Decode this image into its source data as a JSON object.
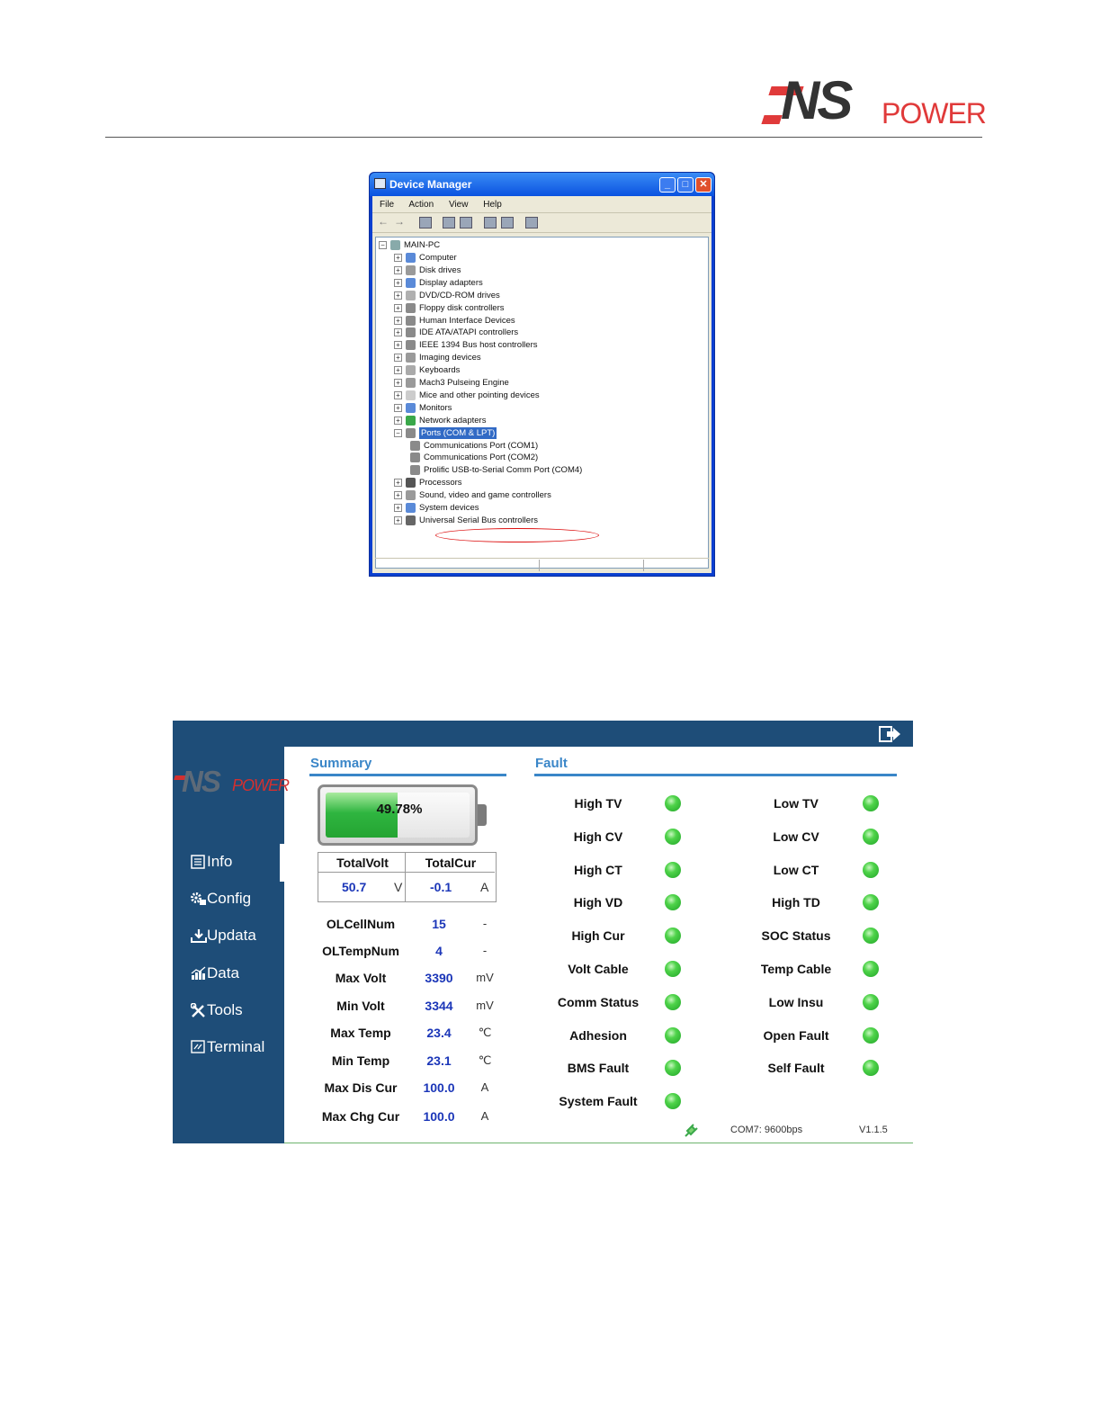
{
  "doc": {
    "logo_main": "NS",
    "logo_sub": "POWER"
  },
  "device_manager": {
    "title": "Device Manager",
    "menu": [
      "File",
      "Action",
      "View",
      "Help"
    ],
    "root": "MAIN-PC",
    "tree": [
      {
        "label": "Computer",
        "level": 1,
        "expand": "+",
        "icon_color": "#5a8ad8"
      },
      {
        "label": "Disk drives",
        "level": 1,
        "expand": "+",
        "icon_color": "#9a9a9a"
      },
      {
        "label": "Display adapters",
        "level": 1,
        "expand": "+",
        "icon_color": "#5a8ad8"
      },
      {
        "label": "DVD/CD-ROM drives",
        "level": 1,
        "expand": "+",
        "icon_color": "#b0b0b0"
      },
      {
        "label": "Floppy disk controllers",
        "level": 1,
        "expand": "+",
        "icon_color": "#8a8a8a"
      },
      {
        "label": "Human Interface Devices",
        "level": 1,
        "expand": "+",
        "icon_color": "#8a8a8a"
      },
      {
        "label": "IDE ATA/ATAPI controllers",
        "level": 1,
        "expand": "+",
        "icon_color": "#8a8a8a"
      },
      {
        "label": "IEEE 1394 Bus host controllers",
        "level": 1,
        "expand": "+",
        "icon_color": "#8a8a8a"
      },
      {
        "label": "Imaging devices",
        "level": 1,
        "expand": "+",
        "icon_color": "#9a9a9a"
      },
      {
        "label": "Keyboards",
        "level": 1,
        "expand": "+",
        "icon_color": "#aaaaaa"
      },
      {
        "label": "Mach3 Pulseing Engine",
        "level": 1,
        "expand": "+",
        "icon_color": "#9a9a9a"
      },
      {
        "label": "Mice and other pointing devices",
        "level": 1,
        "expand": "+",
        "icon_color": "#cccccc"
      },
      {
        "label": "Monitors",
        "level": 1,
        "expand": "+",
        "icon_color": "#5a8ad8"
      },
      {
        "label": "Network adapters",
        "level": 1,
        "expand": "+",
        "icon_color": "#3aa84a"
      },
      {
        "label": "Ports (COM & LPT)",
        "level": 1,
        "expand": "-",
        "icon_color": "#8a8a8a",
        "selected": true
      },
      {
        "label": "Communications Port (COM1)",
        "level": 2,
        "expand": "",
        "icon_color": "#8a8a8a"
      },
      {
        "label": "Communications Port (COM2)",
        "level": 2,
        "expand": "",
        "icon_color": "#8a8a8a"
      },
      {
        "label": "Prolific USB-to-Serial Comm Port (COM4)",
        "level": 2,
        "expand": "",
        "icon_color": "#8a8a8a",
        "highlight": true
      },
      {
        "label": "Processors",
        "level": 1,
        "expand": "+",
        "icon_color": "#555555"
      },
      {
        "label": "Sound, video and game controllers",
        "level": 1,
        "expand": "+",
        "icon_color": "#9a9a9a"
      },
      {
        "label": "System devices",
        "level": 1,
        "expand": "+",
        "icon_color": "#5a8ad8"
      },
      {
        "label": "Universal Serial Bus controllers",
        "level": 1,
        "expand": "+",
        "icon_color": "#666666"
      }
    ]
  },
  "app": {
    "logo_main": "NS",
    "logo_sub": "POWER",
    "nav": [
      {
        "label": "Info",
        "icon": "list-icon"
      },
      {
        "label": "Config",
        "icon": "gears-icon"
      },
      {
        "label": "Updata",
        "icon": "download-icon"
      },
      {
        "label": "Data",
        "icon": "bar-chart-icon"
      },
      {
        "label": "Tools",
        "icon": "tools-icon"
      },
      {
        "label": "Terminal",
        "icon": "terminal-icon"
      }
    ],
    "summary": {
      "title": "Summary",
      "soc_text": "49.78%",
      "soc_fraction": 0.4978,
      "total_volt_label": "TotalVolt",
      "total_cur_label": "TotalCur",
      "total_volt": "50.7",
      "total_volt_unit": "V",
      "total_cur": "-0.1",
      "total_cur_unit": "A",
      "rows": [
        {
          "label": "OLCellNum",
          "value": "15",
          "unit": "-"
        },
        {
          "label": "OLTempNum",
          "value": "4",
          "unit": "-"
        },
        {
          "label": "Max Volt",
          "value": "3390",
          "unit": "mV"
        },
        {
          "label": "Min Volt",
          "value": "3344",
          "unit": "mV"
        },
        {
          "label": "Max Temp",
          "value": "23.4",
          "unit": "℃"
        },
        {
          "label": "Min Temp",
          "value": "23.1",
          "unit": "℃"
        },
        {
          "label": "Max Dis Cur",
          "value": "100.0",
          "unit": "A"
        },
        {
          "label": "Max Chg Cur",
          "value": "100.0",
          "unit": "A"
        }
      ]
    },
    "fault": {
      "title": "Fault",
      "left": [
        "High TV",
        "High CV",
        "High CT",
        "High VD",
        "High Cur",
        "Volt Cable",
        "Comm Status",
        "Adhesion",
        "BMS Fault",
        "System Fault"
      ],
      "right": [
        "Low TV",
        "Low CV",
        "Low CT",
        "High TD",
        "SOC Status",
        "Temp Cable",
        "Low Insu",
        "Open Fault",
        "Self Fault"
      ]
    },
    "status": {
      "port": "COM7: 9600bps",
      "version": "V1.1.5"
    },
    "colors": {
      "sidebar": "#1e4d78",
      "accent": "#3a86c8",
      "value": "#1b36b8",
      "led_ok": "#4fd34a"
    }
  }
}
